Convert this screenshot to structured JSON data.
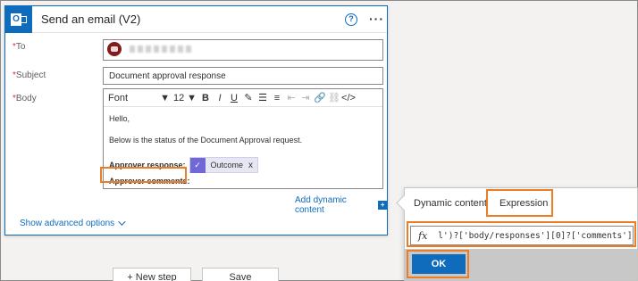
{
  "action": {
    "title": "Send an email (V2)",
    "help_icon_text": "?",
    "more_icon_text": "···"
  },
  "fields": {
    "to_label": "To",
    "subject_label": "Subject",
    "subject_value": "Document approval response",
    "body_label": "Body",
    "required_marker": "*"
  },
  "toolbar": {
    "font": "Font",
    "size": "12",
    "bold": "B",
    "italic": "I",
    "underline": "U"
  },
  "body": {
    "greeting": "Hello,",
    "status_line": "Below is the status of the Document Approval request.",
    "approver_response_label": "Approver response:",
    "approver_comments_label": "Approver comments:",
    "token_label": "Outcome",
    "token_close": "x"
  },
  "links": {
    "add_dynamic": "Add dynamic content",
    "add_dynamic_icon": "+",
    "show_advanced": "Show advanced options"
  },
  "bottom_buttons": {
    "new_step": "+ New step",
    "save": "Save"
  },
  "panel": {
    "tab_dynamic": "Dynamic content",
    "tab_expression": "Expression",
    "fx_label": "fx",
    "expression": "l')?['body/responses'][0]?['comments']",
    "ok_label": "OK"
  },
  "colors": {
    "accent": "#0f6cbd",
    "highlight": "#ea7d25",
    "token_icon": "#7167d8"
  }
}
